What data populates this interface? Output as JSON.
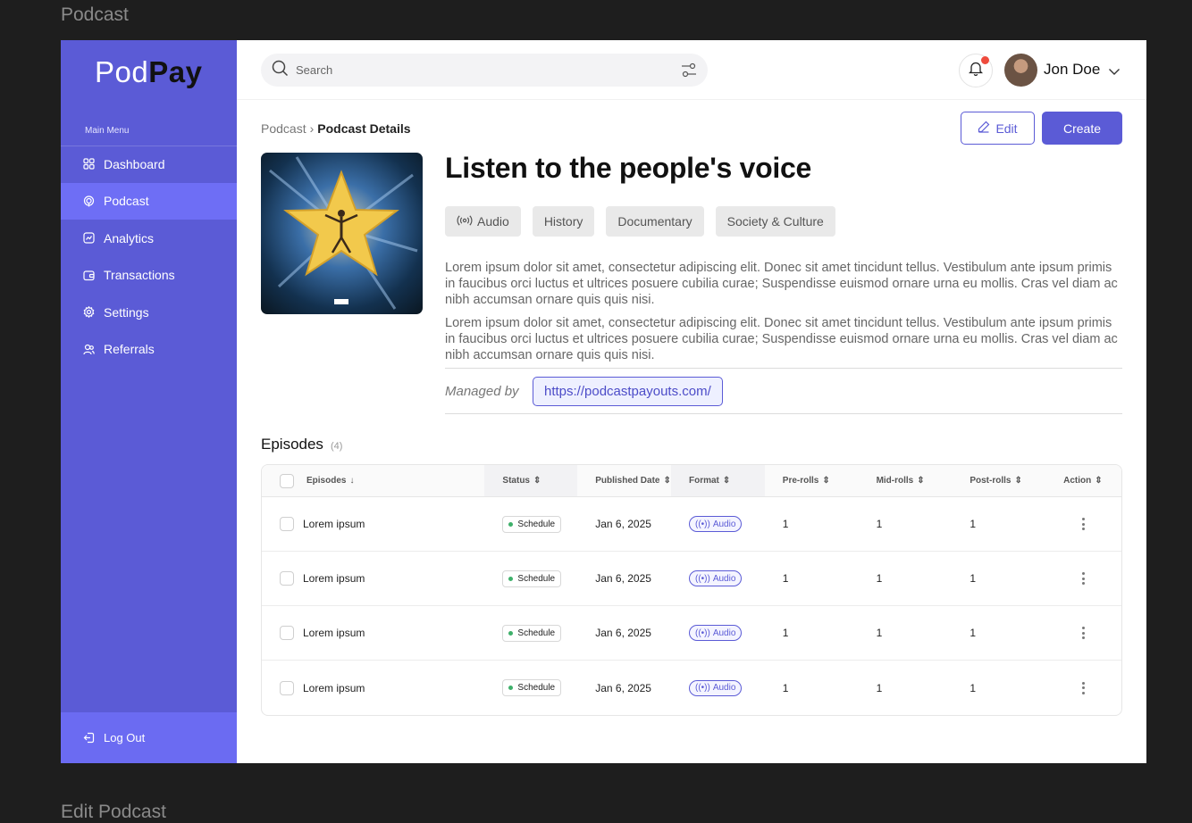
{
  "frame_labels": {
    "top": "Podcast",
    "bottom": "Edit Podcast"
  },
  "brand": {
    "part1": "Pod",
    "part2": "Pay",
    "accent": "#5b5bd6"
  },
  "sidebar": {
    "menu_label": "Main Menu",
    "items": [
      {
        "label": "Dashboard",
        "icon": "grid-icon"
      },
      {
        "label": "Podcast",
        "icon": "podcast-icon",
        "active": true
      },
      {
        "label": "Analytics",
        "icon": "analytics-icon"
      },
      {
        "label": "Transactions",
        "icon": "wallet-icon"
      },
      {
        "label": "Settings",
        "icon": "gear-icon"
      },
      {
        "label": "Referrals",
        "icon": "users-icon"
      }
    ],
    "logout": "Log Out"
  },
  "header": {
    "search_placeholder": "Search",
    "user_name": "Jon Doe"
  },
  "breadcrumb": {
    "parent": "Podcast",
    "current": "Podcast Details"
  },
  "actions": {
    "edit": "Edit",
    "create": "Create"
  },
  "podcast": {
    "title": "Listen to the people's voice",
    "tags": [
      "Audio",
      "History",
      "Documentary",
      "Society & Culture"
    ],
    "description1": "Lorem ipsum dolor sit amet, consectetur adipiscing elit. Donec sit amet tincidunt tellus. Vestibulum ante ipsum primis in faucibus orci luctus et ultrices posuere cubilia curae; Suspendisse euismod ornare urna eu mollis. Cras vel diam ac nibh accumsan ornare quis quis nisi.",
    "description2": "Lorem ipsum dolor sit amet, consectetur adipiscing elit. Donec sit amet tincidunt tellus. Vestibulum ante ipsum primis in faucibus orci luctus et ultrices posuere cubilia curae; Suspendisse euismod ornare urna eu mollis. Cras vel diam ac nibh accumsan ornare quis quis nisi.",
    "managed_label": "Managed by",
    "managed_url": "https://podcastpayouts.com/"
  },
  "episodes": {
    "title": "Episodes",
    "count": "(4)",
    "columns": [
      "Episodes",
      "Status",
      "Published Date",
      "Format",
      "Pre-rolls",
      "Mid-rolls",
      "Post-rolls",
      "Action"
    ],
    "rows": [
      {
        "name": "Lorem ipsum",
        "status": "Schedule",
        "date": "Jan 6, 2025",
        "format": "Audio",
        "pre": "1",
        "mid": "1",
        "post": "1"
      },
      {
        "name": "Lorem ipsum",
        "status": "Schedule",
        "date": "Jan 6, 2025",
        "format": "Audio",
        "pre": "1",
        "mid": "1",
        "post": "1"
      },
      {
        "name": "Lorem ipsum",
        "status": "Schedule",
        "date": "Jan 6, 2025",
        "format": "Audio",
        "pre": "1",
        "mid": "1",
        "post": "1"
      },
      {
        "name": "Lorem ipsum",
        "status": "Schedule",
        "date": "Jan 6, 2025",
        "format": "Audio",
        "pre": "1",
        "mid": "1",
        "post": "1"
      }
    ]
  }
}
